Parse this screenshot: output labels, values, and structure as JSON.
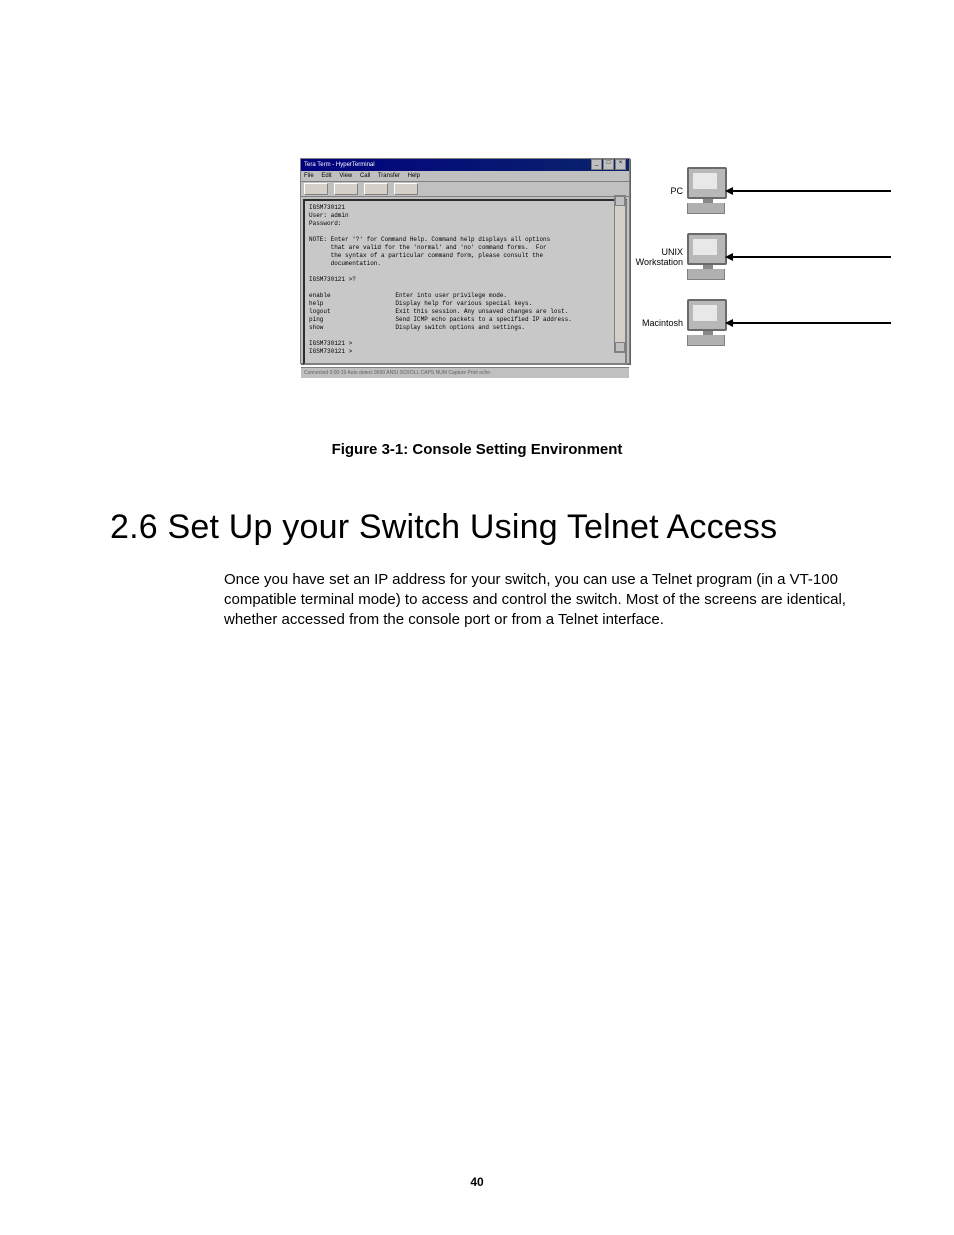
{
  "figure": {
    "caption": "Figure 3-1: Console Setting Environment",
    "terminal": {
      "title": "Tera Term - HyperTerminal",
      "menus": [
        "File",
        "Edit",
        "View",
        "Call",
        "Transfer",
        "Help"
      ],
      "body": "IGSM730121\nUser: admin\nPassword:\n\nNOTE: Enter '?' for Command Help. Command help displays all options\n      that are valid for the 'normal' and 'no' command forms.  For\n      the syntax of a particular command form, please consult the\n      documentation.\n\nIGSM730121 >?\n\nenable                  Enter into user privilege mode.\nhelp                    Display help for various special keys.\nlogout                  Exit this session. Any unsaved changes are lost.\nping                    Send ICMP echo packets to a specified IP address.\nshow                    Display switch options and settings.\n\nIGSM730121 >\nIGSM730121 >",
      "status": "Connected 0:00:19    Auto detect    9600    ANSI   SCROLL   CAPS   NUM   Capture   Print echo"
    },
    "clients": [
      {
        "label": "PC"
      },
      {
        "label": "UNIX\nWorkstation"
      },
      {
        "label": "Macintosh"
      }
    ]
  },
  "heading": "2.6 Set Up your Switch Using Telnet Access",
  "paragraph": "Once you have set an IP address for your switch, you can use a Telnet program (in a VT-100 compatible terminal mode) to access and control the switch. Most of the screens are identical, whether accessed from the console port or from a Telnet interface.",
  "pageNumber": "40"
}
